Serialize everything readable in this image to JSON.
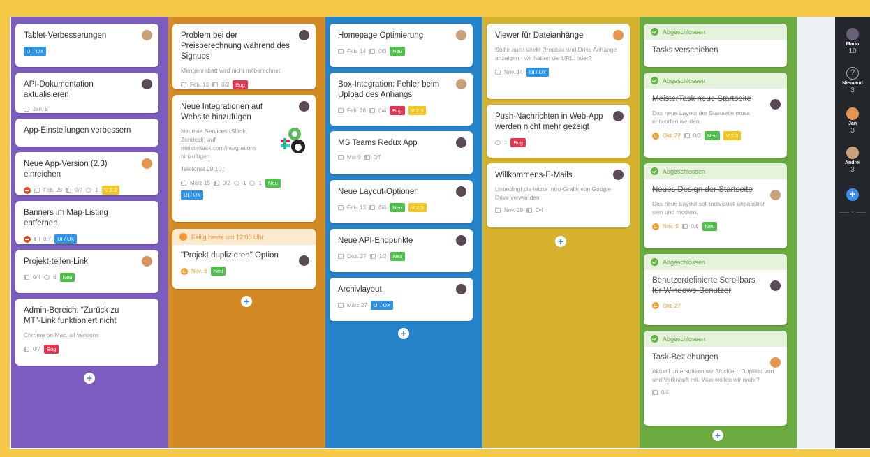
{
  "columns": {
    "col1": [
      {
        "title": "Tablet-Verbesserungen",
        "tag": "UI / UX"
      },
      {
        "title": "API-Dokumentation aktualisieren",
        "date": "Jan. 5"
      },
      {
        "title": "App-Einstellungen verbessern"
      },
      {
        "title": "Neue App-Version (2.3) einreichen",
        "date": "Feb. 28",
        "checklist": "0/7",
        "attach": "1",
        "tag": "V 2.3"
      },
      {
        "title": "Banners im Map-Listing entfernen",
        "checklist": "0/7",
        "tag": "UI / UX"
      },
      {
        "title": "Projekt-teilen-Link",
        "checklist": "0/4",
        "attach": "6",
        "tag": "Neu"
      },
      {
        "title": "Admin-Bereich: \"Zurück zu MT\"-Link funktioniert nicht",
        "desc": "Chrome on Mac, all versions",
        "checklist": "0/7",
        "tag": "Bug"
      }
    ],
    "col2": [
      {
        "title": "Problem bei der Preisberechnung während des Signups",
        "desc": "Mengenrabatt wird nicht mitberechnet",
        "date": "Feb. 13",
        "checklist": "0/2",
        "tag": "Bug"
      },
      {
        "title": "Neue Integrationen auf Website hinzufügen",
        "desc": "Neueste Services (Slack, Zendesk) auf meistertask.com/integrations hinzufügen",
        "desc2": "Telefonat 29.10.:",
        "date": "März 15",
        "checklist": "0/2",
        "comments": "1",
        "attach": "1",
        "tag": "Neu",
        "tag2": "UI / UX"
      },
      {
        "banner": "Fällig heute um 12:00 Uhr",
        "title": "\"Projekt duplizieren\" Option",
        "due": "Nov. 6",
        "tag": "Neu"
      }
    ],
    "col3": [
      {
        "title": "Homepage Optimierung",
        "date": "Feb. 14",
        "checklist": "0/3",
        "tag": "Neu"
      },
      {
        "title": "Box-Integration: Fehler beim Upload des Anhangs",
        "date": "Feb. 28",
        "checklist": "0/4",
        "tag": "Bug",
        "tag2": "V 2.3"
      },
      {
        "title": "MS Teams Redux App",
        "date": "Mai 9",
        "checklist": "0/7"
      },
      {
        "title": "Neue Layout-Optionen",
        "date": "Feb. 13",
        "checklist": "0/4",
        "tag": "Neu",
        "tag2": "V 2.3"
      },
      {
        "title": "Neue API-Endpunkte",
        "date": "Dez. 27",
        "checklist": "1/2",
        "tag": "Neu"
      },
      {
        "title": "Archivlayout",
        "date": "März 27",
        "tag": "UI / UX"
      }
    ],
    "col4": [
      {
        "title": "Viewer für Dateianhänge",
        "desc": "Sollte auch direkt Dropbox und Drive Anhänge anzeigen - wir haben die URL, oder?",
        "date": "Nov. 14",
        "tag": "UI / UX"
      },
      {
        "title": "Push-Nachrichten in Web-App werden nicht mehr gezeigt",
        "comments": "1",
        "tag": "Bug"
      },
      {
        "title": "Willkommens-E-Mails",
        "desc": "Unbedingt die letzte Intro-Grafik von Google Drive verwenden",
        "date": "Nov. 29",
        "checklist": "0/4"
      }
    ],
    "col5": [
      {
        "banner": "Abgeschlossen",
        "title": "Tasks verschieben"
      },
      {
        "banner": "Abgeschlossen",
        "title": "MeisterTask neue Startseite",
        "desc": "Das neue Layout der Startseite muss entworfen werden.",
        "due": "Okt. 22",
        "checklist": "0/3",
        "tag": "Neu",
        "tag2": "V 2.3"
      },
      {
        "banner": "Abgeschlossen",
        "title": "Neues Design der Startseite",
        "desc": "Das neue Layout soll individuell anpassbar sein und modern.",
        "due": "Nov. 5",
        "checklist": "0/6",
        "tag": "Neu"
      },
      {
        "banner": "Abgeschlossen",
        "title": "Benutzerdefinierte Scrollbars für Windows-Benutzer",
        "due": "Okt. 27"
      },
      {
        "banner": "Abgeschlossen",
        "title": "Task-Beziehungen",
        "desc": "Aktuell unterstützen wir Blockiert, Duplikat von und Verknüpft mit. Was wollen wir mehr?",
        "checklist": "0/4"
      }
    ]
  },
  "plus_label": "+",
  "users": [
    {
      "name": "Mario",
      "count": "10"
    },
    {
      "name": "Niemand",
      "count": "3",
      "icon": "?"
    },
    {
      "name": "Jan",
      "count": "3"
    },
    {
      "name": "Andrei",
      "count": "3"
    }
  ],
  "colors": {
    "purple": "#7c5cbf",
    "orange": "#d38a25",
    "blue": "#2583c9",
    "yellow": "#d6b12e",
    "green": "#6aaa3f"
  }
}
